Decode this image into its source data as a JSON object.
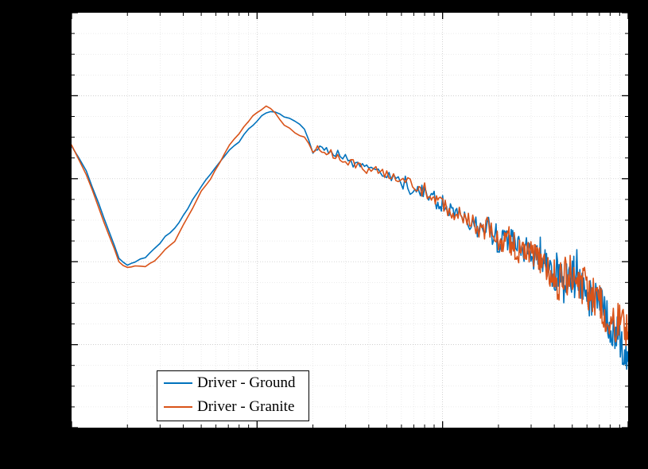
{
  "chart_data": {
    "type": "line",
    "title": "",
    "xlabel": "",
    "ylabel": "",
    "xscale": "log",
    "xlim": [
      10,
      10000
    ],
    "ylim": [
      -140,
      -40
    ],
    "x_major_ticks": [
      10,
      100,
      1000,
      10000
    ],
    "y_major_ticks": [
      -140,
      -120,
      -100,
      -80,
      -60,
      -40
    ],
    "legend_position": "lower-left",
    "series": [
      {
        "name": "Driver - Ground",
        "color": "#0072BD",
        "x": [
          10,
          12,
          14,
          16,
          18,
          20,
          22,
          25,
          28,
          32,
          36,
          40,
          45,
          50,
          56,
          63,
          71,
          80,
          90,
          100,
          112,
          125,
          140,
          160,
          180,
          200,
          224,
          250,
          280,
          320,
          360,
          400,
          450,
          500,
          560,
          630,
          710,
          800,
          900,
          1000,
          1120,
          1250,
          1400,
          1600,
          1800,
          2000,
          2240,
          2500,
          2800,
          3200,
          3600,
          4000,
          4500,
          5000,
          5600,
          6300,
          7100,
          8000,
          9000,
          10000
        ],
        "y": [
          -72,
          -78,
          -86,
          -93,
          -99,
          -101,
          -100,
          -99,
          -97,
          -94,
          -92,
          -89,
          -85,
          -82,
          -79,
          -76,
          -73,
          -71,
          -68,
          -66,
          -64,
          -64,
          -65,
          -66,
          -68,
          -73,
          -72,
          -74,
          -74,
          -76,
          -77,
          -77,
          -78,
          -79,
          -80,
          -81,
          -83,
          -83,
          -85,
          -86,
          -88,
          -89,
          -91,
          -92,
          -92,
          -95,
          -94,
          -96,
          -97,
          -99,
          -100,
          -104,
          -105,
          -103,
          -106,
          -109,
          -111,
          -116,
          -118,
          -124
        ],
        "noise": 0.0
      },
      {
        "name": "Driver - Granite",
        "color": "#D95319",
        "x": [
          10,
          12,
          14,
          16,
          18,
          20,
          22,
          25,
          28,
          32,
          36,
          40,
          45,
          50,
          56,
          63,
          71,
          80,
          90,
          100,
          112,
          125,
          140,
          160,
          180,
          200,
          224,
          250,
          280,
          320,
          360,
          400,
          450,
          500,
          560,
          630,
          710,
          800,
          900,
          1000,
          1120,
          1250,
          1400,
          1600,
          1800,
          2000,
          2240,
          2500,
          2800,
          3200,
          3600,
          4000,
          4500,
          5000,
          5600,
          6300,
          7100,
          8000,
          9000,
          10000
        ],
        "y": [
          -72,
          -79,
          -87,
          -94,
          -100,
          -101.5,
          -101,
          -101,
          -100,
          -97,
          -95,
          -91,
          -87,
          -83,
          -80,
          -76,
          -72,
          -69,
          -66,
          -64,
          -62.5,
          -64,
          -67,
          -69,
          -70,
          -73,
          -73,
          -74,
          -75,
          -76,
          -77,
          -78,
          -78,
          -79,
          -80,
          -81,
          -82,
          -83,
          -85,
          -86,
          -88,
          -89,
          -90,
          -92,
          -92,
          -95,
          -94,
          -97,
          -97,
          -99,
          -101,
          -105,
          -104,
          -102,
          -105,
          -108,
          -110,
          -114,
          -115,
          -117
        ],
        "noise": 0.0
      }
    ]
  },
  "legend": {
    "items": [
      {
        "label": "Driver - Ground",
        "color": "#0072BD"
      },
      {
        "label": "Driver - Granite",
        "color": "#D95319"
      }
    ]
  }
}
